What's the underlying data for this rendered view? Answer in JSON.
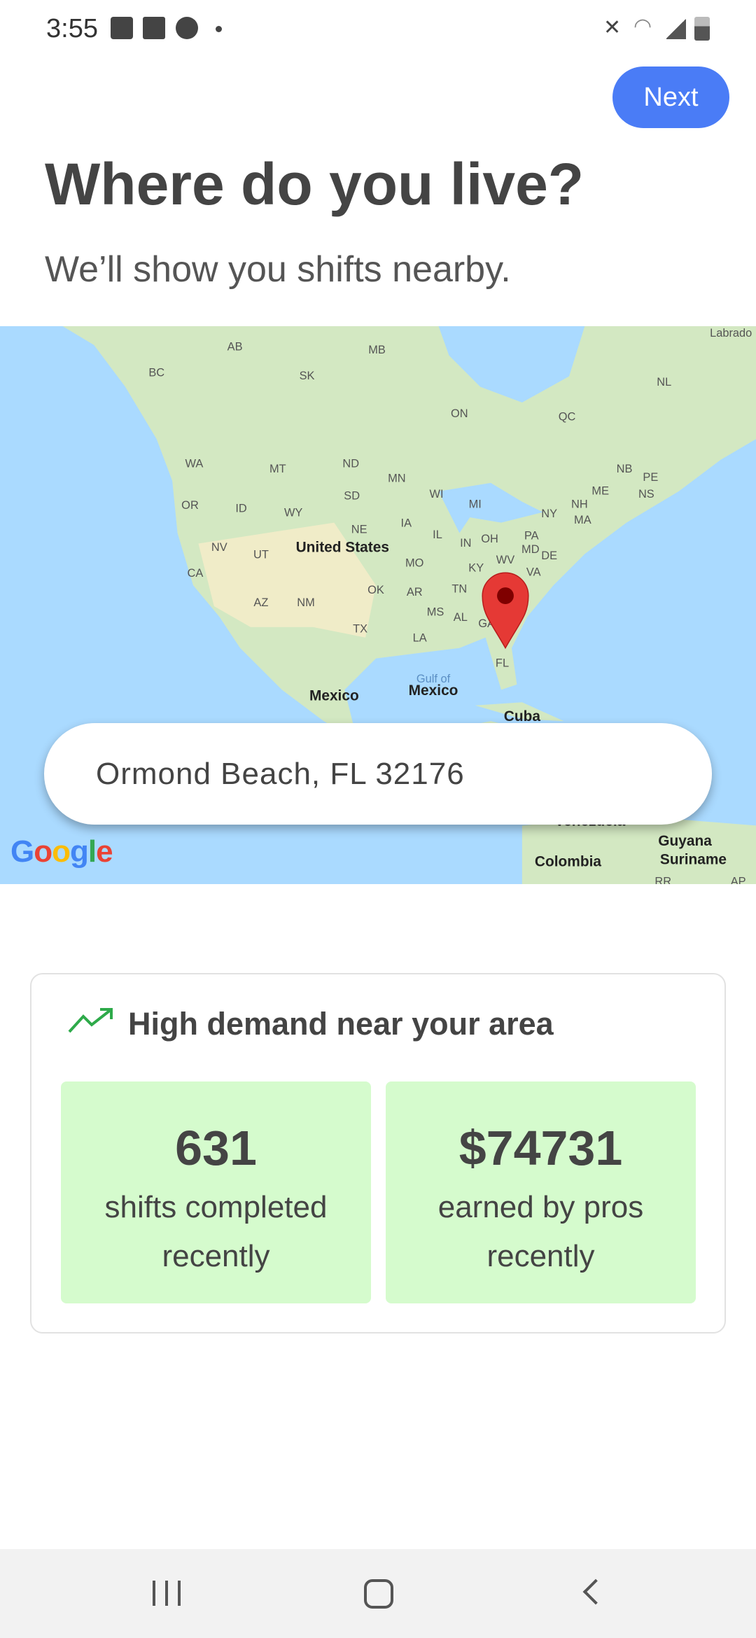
{
  "status_bar": {
    "time": "3:55",
    "icons": [
      "image-icon",
      "message-icon",
      "account-icon",
      "dot-icon",
      "mute-icon",
      "wifi-icon",
      "signal-icon",
      "battery-icon"
    ]
  },
  "header": {
    "next_label": "Next",
    "title": "Where do you live?",
    "subtitle": "We’ll show you shifts nearby."
  },
  "map": {
    "labels": [
      "AB",
      "BC",
      "SK",
      "MB",
      "ON",
      "QC",
      "NL",
      "Labrado",
      "WA",
      "MT",
      "ND",
      "MN",
      "OR",
      "ID",
      "WY",
      "SD",
      "WI",
      "MI",
      "NY",
      "NH",
      "MA",
      "ME",
      "NB",
      "PE",
      "NS",
      "NV",
      "UT",
      "United States",
      "NE",
      "IA",
      "IL",
      "IN",
      "OH",
      "PA",
      "MD",
      "DE",
      "WV",
      "VA",
      "CA",
      "MO",
      "KY",
      "TN",
      "AZ",
      "NM",
      "OK",
      "AR",
      "MS",
      "AL",
      "GA",
      "TX",
      "LA",
      "FL",
      "Gulf of",
      "Mexico",
      "Mexico",
      "Cuba",
      "Venezuela",
      "Guyana",
      "Colombia",
      "Suriname",
      "RR",
      "AP"
    ],
    "logo": "Google",
    "colors": {
      "water": "#aadaff",
      "land": "#d3e8c2",
      "pin": "#e53935"
    }
  },
  "search": {
    "value": "Ormond Beach, FL 32176"
  },
  "demand": {
    "title": "High demand near your area",
    "icon": "trending-up-icon",
    "accent": "#2eaa4a",
    "stats": [
      {
        "value": "631",
        "label": "shifts completed recently"
      },
      {
        "value": "$74731",
        "label": "earned by pros recently"
      }
    ],
    "tile_color": "#d5fbcd"
  },
  "nav": {
    "buttons": [
      "recents-button",
      "home-button",
      "back-button"
    ]
  }
}
